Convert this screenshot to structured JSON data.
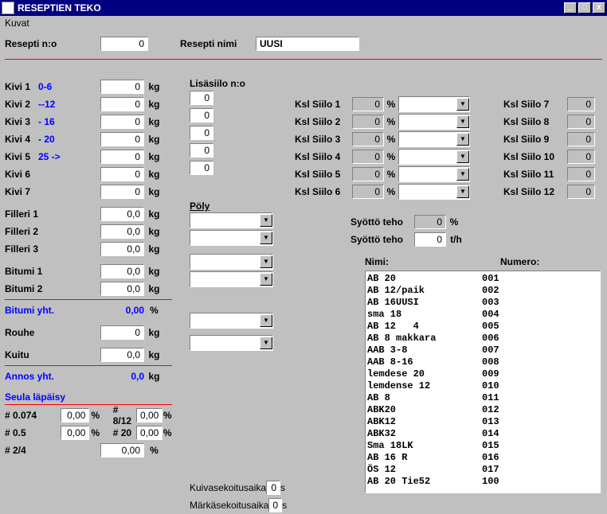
{
  "title": "RESEPTIEN TEKO",
  "menu": {
    "kuvat": "Kuvat"
  },
  "top": {
    "resepti_nro_label": "Resepti n:o",
    "resepti_nro_value": "0",
    "resepti_nimi_label": "Resepti nimi",
    "resepti_nimi_value": "UUSI"
  },
  "lisasiilo_label": "Lisäsiilo n:o",
  "kivit": [
    {
      "label": "Kivi 1",
      "range": "0-6",
      "val": "0",
      "unit": "kg",
      "lisasiilo": "0"
    },
    {
      "label": "Kivi 2",
      "range": "--12",
      "val": "0",
      "unit": "kg",
      "lisasiilo": "0"
    },
    {
      "label": "Kivi 3",
      "range": "- 16",
      "val": "0",
      "unit": "kg",
      "lisasiilo": "0"
    },
    {
      "label": "Kivi 4",
      "range": "- 20",
      "val": "0",
      "unit": "kg",
      "lisasiilo": "0"
    },
    {
      "label": "Kivi 5",
      "range": "25 ->",
      "val": "0",
      "unit": "kg",
      "lisasiilo": "0"
    },
    {
      "label": "Kivi 6",
      "range": "",
      "val": "0",
      "unit": "kg",
      "lisasiilo": ""
    },
    {
      "label": "Kivi 7",
      "range": "",
      "val": "0",
      "unit": "kg",
      "lisasiilo": ""
    }
  ],
  "fillerit": [
    {
      "label": "Filleri 1",
      "val": "0,0",
      "unit": "kg"
    },
    {
      "label": "Filleri 2",
      "val": "0,0",
      "unit": "kg"
    },
    {
      "label": "Filleri 3",
      "val": "0,0",
      "unit": "kg"
    }
  ],
  "bitumit": [
    {
      "label": "Bitumi 1",
      "val": "0,0",
      "unit": "kg"
    },
    {
      "label": "Bitumi 2",
      "val": "0,0",
      "unit": "kg"
    }
  ],
  "bitumi_yht": {
    "label": "Bitumi yht.",
    "val": "0,00",
    "unit": "%"
  },
  "rouhe": {
    "label": "Rouhe",
    "val": "0",
    "unit": "kg"
  },
  "kuitu": {
    "label": "Kuitu",
    "val": "0,0",
    "unit": "kg"
  },
  "annos_yht": {
    "label": "Annos yht.",
    "val": "0,0",
    "unit": "kg"
  },
  "poly_label": "Pöly",
  "sekoitusajat": {
    "kuiva_label": "Kuivasekoitusaika",
    "kuiva_val": "0",
    "kuiva_unit": "s",
    "marka_label": "Märkäsekoitusaika",
    "marka_val": "0",
    "marka_unit": "s"
  },
  "seula_label": "Seula läpäisy",
  "seulat": [
    {
      "label": "# 0.074",
      "val": "0,00",
      "unit": "%"
    },
    {
      "label": "# 0.5",
      "val": "0,00",
      "unit": "%"
    },
    {
      "label": "# 2/4",
      "val": "0,00",
      "unit": "%"
    },
    {
      "label": "# 8/12",
      "val": "0,00",
      "unit": "%"
    },
    {
      "label": "# 20",
      "val": "0,00",
      "unit": "%"
    }
  ],
  "ksl_siilot": [
    {
      "label": "Ksl Siilo 1",
      "val": "0",
      "unit": "%"
    },
    {
      "label": "Ksl Siilo 2",
      "val": "0",
      "unit": "%"
    },
    {
      "label": "Ksl Siilo 3",
      "val": "0",
      "unit": "%"
    },
    {
      "label": "Ksl Siilo 4",
      "val": "0",
      "unit": "%"
    },
    {
      "label": "Ksl Siilo 5",
      "val": "0",
      "unit": "%"
    },
    {
      "label": "Ksl Siilo 6",
      "val": "0",
      "unit": "%"
    }
  ],
  "ksl_siilot2": [
    {
      "label": "Ksl Siilo 7",
      "val": "0"
    },
    {
      "label": "Ksl Siilo 8",
      "val": "0"
    },
    {
      "label": "Ksl Siilo 9",
      "val": "0"
    },
    {
      "label": "Ksl Siilo 10",
      "val": "0"
    },
    {
      "label": "Ksl Siilo 11",
      "val": "0"
    },
    {
      "label": "Ksl Siilo 12",
      "val": "0"
    }
  ],
  "syotto": {
    "teho_pct_label": "Syöttö teho",
    "teho_pct_val": "0",
    "teho_pct_unit": "%",
    "teho_th_label": "Syöttö teho",
    "teho_th_val": "0",
    "teho_th_unit": "t/h"
  },
  "list_headers": {
    "nimi": "Nimi:",
    "numero": "Numero:"
  },
  "reseptit": [
    {
      "nimi": "AB 20",
      "numero": "001"
    },
    {
      "nimi": "AB 12/paik",
      "numero": "002"
    },
    {
      "nimi": "AB 16UUSI",
      "numero": "003"
    },
    {
      "nimi": "sma 18",
      "numero": "004"
    },
    {
      "nimi": "AB 12   4",
      "numero": "005"
    },
    {
      "nimi": "AB 8 makkara",
      "numero": "006"
    },
    {
      "nimi": "AAB 3-8",
      "numero": "007"
    },
    {
      "nimi": "AAB 8-16",
      "numero": "008"
    },
    {
      "nimi": "lemdese 20",
      "numero": "009"
    },
    {
      "nimi": "lemdense 12",
      "numero": "010"
    },
    {
      "nimi": "AB 8",
      "numero": "011"
    },
    {
      "nimi": "ABK20",
      "numero": "012"
    },
    {
      "nimi": "ABK12",
      "numero": "013"
    },
    {
      "nimi": "ABK32",
      "numero": "014"
    },
    {
      "nimi": "Sma 18LK",
      "numero": "015"
    },
    {
      "nimi": "AB 16 R",
      "numero": "016"
    },
    {
      "nimi": "ÖS 12",
      "numero": "017"
    },
    {
      "nimi": "AB 20 Tie52",
      "numero": "100"
    }
  ]
}
